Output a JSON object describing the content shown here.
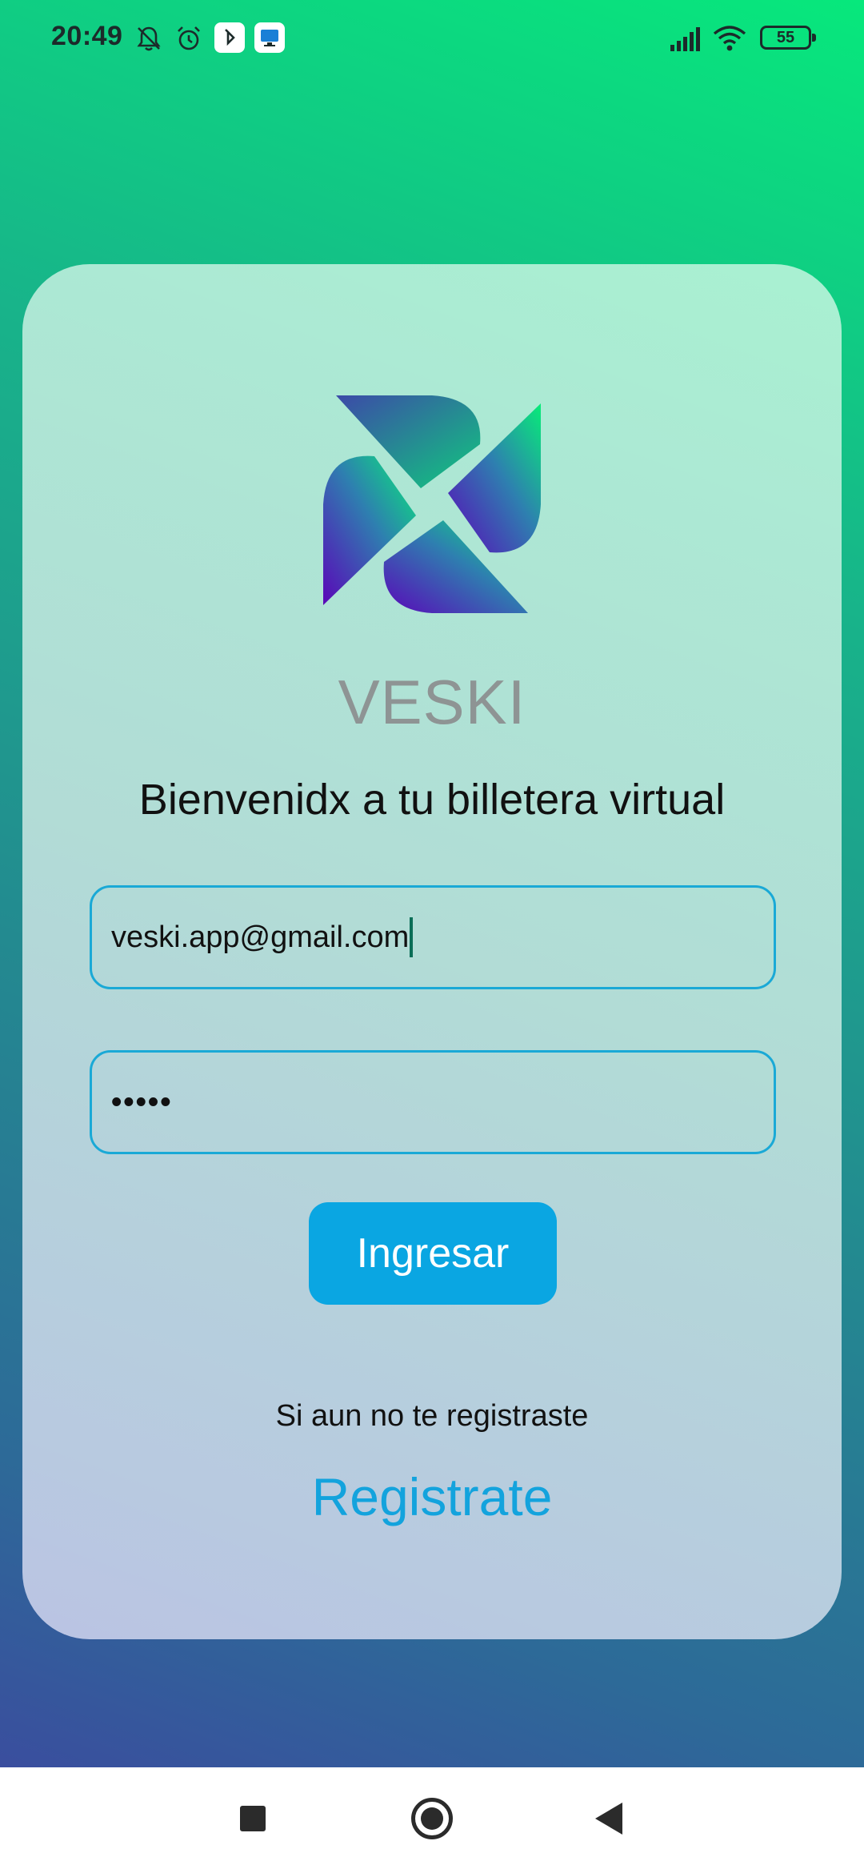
{
  "status_bar": {
    "time": "20:49",
    "battery": "55",
    "icons": [
      "bell-off-icon",
      "alarm-icon",
      "app-notification-icon",
      "screen-icon",
      "signal-icon",
      "wifi-icon",
      "battery-icon"
    ]
  },
  "app": {
    "name": "VESKI",
    "welcome": "Bienvenidx a tu billetera virtual"
  },
  "login": {
    "email_value": "veski.app@gmail.com",
    "password_value": "•••••",
    "submit_label": "Ingresar",
    "register_hint": "Si aun no te registraste",
    "register_label": "Registrate"
  },
  "colors": {
    "accent": "#0aa6e2",
    "link": "#13a3dd",
    "field_border": "#1aa9d6",
    "gradient_top": "#07e87c",
    "gradient_bottom": "#3a4e9e"
  }
}
